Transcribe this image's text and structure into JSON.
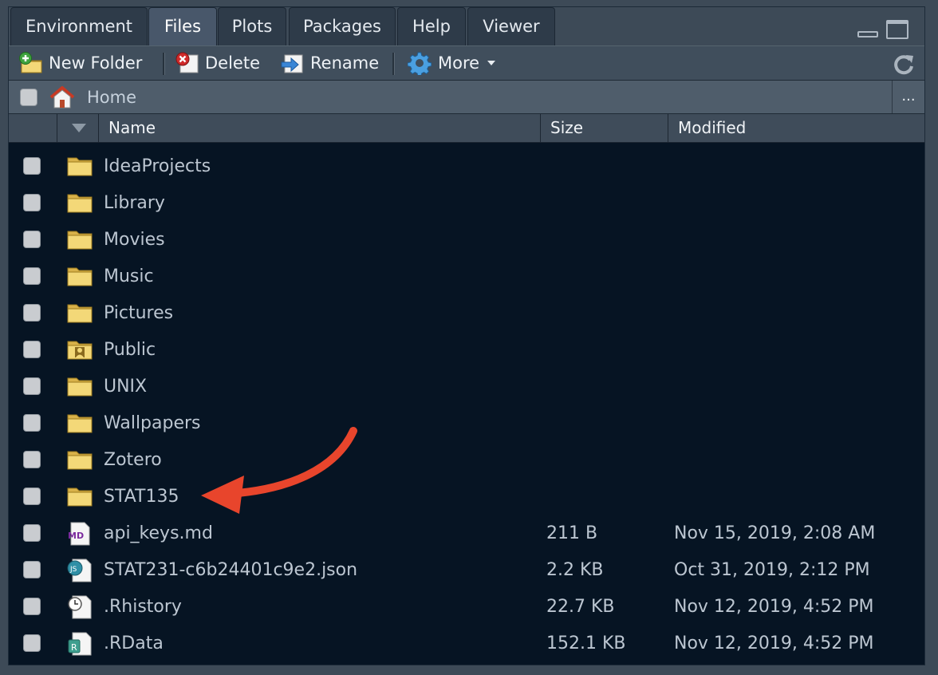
{
  "tabs": [
    {
      "label": "Environment",
      "active": false
    },
    {
      "label": "Files",
      "active": true
    },
    {
      "label": "Plots",
      "active": false
    },
    {
      "label": "Packages",
      "active": false
    },
    {
      "label": "Help",
      "active": false
    },
    {
      "label": "Viewer",
      "active": false
    }
  ],
  "toolbar": {
    "new_folder": "New Folder",
    "delete": "Delete",
    "rename": "Rename",
    "more": "More"
  },
  "path": {
    "home": "Home",
    "overflow": "..."
  },
  "columns": {
    "name": "Name",
    "size": "Size",
    "modified": "Modified"
  },
  "files": [
    {
      "name": "IdeaProjects",
      "type": "folder",
      "size": "",
      "modified": ""
    },
    {
      "name": "Library",
      "type": "folder",
      "size": "",
      "modified": ""
    },
    {
      "name": "Movies",
      "type": "folder",
      "size": "",
      "modified": ""
    },
    {
      "name": "Music",
      "type": "folder",
      "size": "",
      "modified": ""
    },
    {
      "name": "Pictures",
      "type": "folder",
      "size": "",
      "modified": ""
    },
    {
      "name": "Public",
      "type": "public-folder",
      "size": "",
      "modified": ""
    },
    {
      "name": "UNIX",
      "type": "folder",
      "size": "",
      "modified": ""
    },
    {
      "name": "Wallpapers",
      "type": "folder",
      "size": "",
      "modified": ""
    },
    {
      "name": "Zotero",
      "type": "folder",
      "size": "",
      "modified": ""
    },
    {
      "name": "STAT135",
      "type": "folder",
      "size": "",
      "modified": ""
    },
    {
      "name": "api_keys.md",
      "type": "markdown",
      "size": "211 B",
      "modified": "Nov 15, 2019, 2:08 AM"
    },
    {
      "name": "STAT231-c6b24401c9e2.json",
      "type": "json",
      "size": "2.2 KB",
      "modified": "Oct 31, 2019, 2:12 PM"
    },
    {
      "name": ".Rhistory",
      "type": "rhistory",
      "size": "22.7 KB",
      "modified": "Nov 12, 2019, 4:52 PM"
    },
    {
      "name": ".RData",
      "type": "rdata",
      "size": "152.1 KB",
      "modified": "Nov 12, 2019, 4:52 PM"
    }
  ],
  "colors": {
    "pane_bg": "#061423",
    "toolbar_bg": "#404e5c",
    "annotation_arrow": "#e8452c",
    "folder": "#e9c65b"
  }
}
